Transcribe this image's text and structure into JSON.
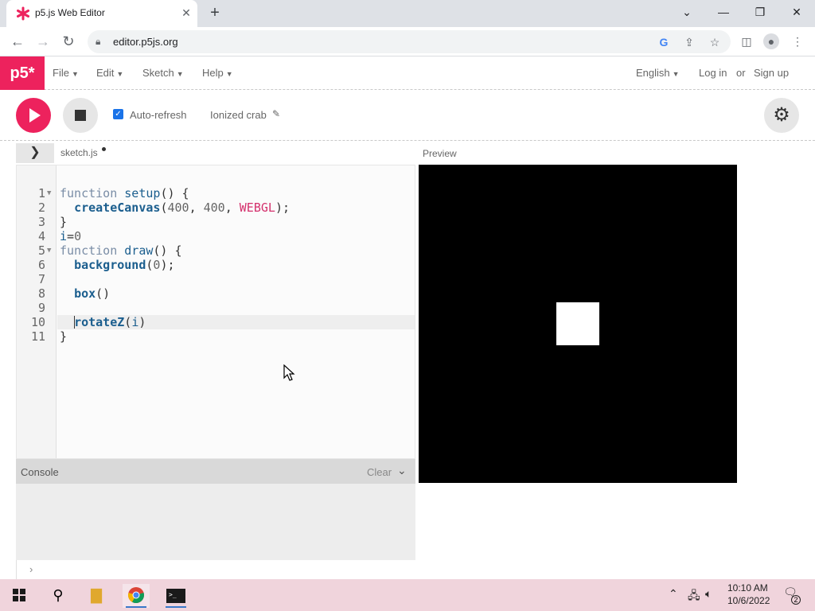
{
  "browser": {
    "tab_title": "p5.js Web Editor",
    "tab_close": "✕",
    "new_tab": "+",
    "url": "editor.p5js.org",
    "window_minimize": "—",
    "window_restore": "❐",
    "window_close": "✕",
    "nav_back": "←",
    "nav_forward": "→",
    "nav_reload": "↻"
  },
  "p5": {
    "logo": "p5*",
    "menu": [
      "File",
      "Edit",
      "Sketch",
      "Help"
    ],
    "language": "English",
    "login": "Log in",
    "or": "or",
    "signup": "Sign up",
    "autorefresh_label": "Auto-refresh",
    "autorefresh_checked": true,
    "sketch_name": "Ionized crab",
    "file_tab": "sketch.js",
    "preview_label": "Preview"
  },
  "editor": {
    "line_numbers": [
      "1",
      "2",
      "3",
      "4",
      "5",
      "6",
      "7",
      "8",
      "9",
      "10",
      "11"
    ],
    "active_line": 10
  },
  "console": {
    "title": "Console",
    "clear_label": "Clear",
    "prompt": "›"
  },
  "taskbar": {
    "time": "10:10 AM",
    "date": "10/6/2022",
    "notification_count": "2"
  },
  "colors": {
    "accent": "#ed225d",
    "taskbar": "#f0d4dc"
  }
}
